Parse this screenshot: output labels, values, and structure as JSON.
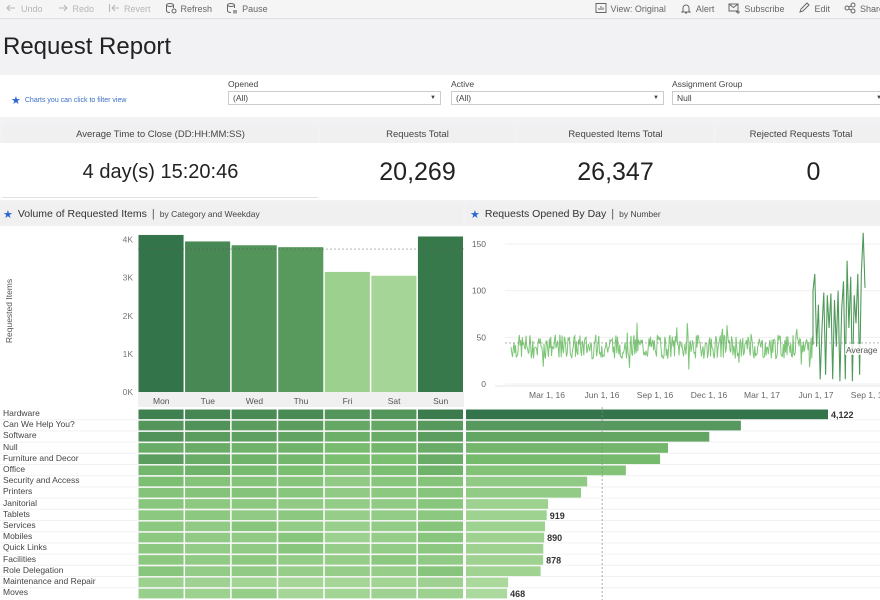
{
  "toolbar": {
    "left": [
      {
        "label": "Undo",
        "icon": "undo-arrow-icon",
        "disabled": true
      },
      {
        "label": "Redo",
        "icon": "redo-arrow-icon",
        "disabled": true
      },
      {
        "label": "Revert",
        "icon": "revert-icon",
        "disabled": true
      },
      {
        "label": "Refresh",
        "icon": "refresh-database-icon",
        "disabled": false
      },
      {
        "label": "Pause",
        "icon": "pause-database-icon",
        "disabled": false
      }
    ],
    "right": [
      {
        "label": "View: Original",
        "icon": "view-chart-icon"
      },
      {
        "label": "Alert",
        "icon": "bell-icon"
      },
      {
        "label": "Subscribe",
        "icon": "envelope-plus-icon"
      },
      {
        "label": "Edit",
        "icon": "pencil-icon"
      },
      {
        "label": "Share",
        "icon": "share-icon"
      }
    ]
  },
  "page_title": "Request Report",
  "hint": "Charts you can click to filter view",
  "filters": [
    {
      "label": "Opened",
      "value": "(All)"
    },
    {
      "label": "Active",
      "value": "(All)"
    },
    {
      "label": "Assignment Group",
      "value": "Null"
    }
  ],
  "kpis": [
    {
      "label": "Average Time to Close (DD:HH:MM:SS)",
      "value": "4 day(s) 15:20:46"
    },
    {
      "label": "Requests Total",
      "value": "20,269"
    },
    {
      "label": "Requested Items Total",
      "value": "26,347"
    },
    {
      "label": "Rejected Requests Total",
      "value": "0"
    }
  ],
  "panels": {
    "volume": {
      "title": "Volume of Requested Items",
      "sep": "|",
      "subtitle": "by Category and Weekday"
    },
    "opened": {
      "title": "Requests Opened By Day",
      "sep": "|",
      "subtitle": "by Number"
    }
  },
  "colors": {
    "accent_star": "#2b66d0",
    "dark_green": "#3a7a4c",
    "light_green": "#b8e0a8",
    "line_green": "#7cc576"
  },
  "chart_data": [
    {
      "type": "bar",
      "title": "Volume of Requested Items by Weekday",
      "categories": [
        "Mon",
        "Tue",
        "Wed",
        "Thu",
        "Fri",
        "Sat",
        "Sun"
      ],
      "values": [
        4120,
        3950,
        3850,
        3800,
        3150,
        3050,
        4080
      ],
      "ylabel": "Requested Items",
      "yticks": [
        "0K",
        "1K",
        "2K",
        "3K",
        "4K"
      ],
      "ylim": [
        0,
        4250
      ],
      "average": 3750
    },
    {
      "type": "line",
      "title": "Requests Opened By Day",
      "xticks": [
        "Mar 1, 16",
        "Jun 1, 16",
        "Sep 1, 16",
        "Dec 1, 16",
        "Mar 1, 17",
        "Jun 1, 17",
        "Sep 1, 17"
      ],
      "yticks": [
        "0",
        "50",
        "100",
        "150"
      ],
      "ylim": [
        0,
        165
      ],
      "average": 44,
      "average_label": "Average",
      "x_range": [
        "Jan 2016",
        "Sep 2017"
      ],
      "series_description": "daily counts ~25-65 through May 2017; from Jun 2017 strong weekly oscillation 0-120, peak ~162 in early Sep 2017",
      "series": [
        {
          "name": "Requests",
          "segments": [
            {
              "from": "2016-01",
              "to": "2017-05",
              "min": 18,
              "max": 66,
              "mean": 40
            },
            {
              "from": "2017-06",
              "to": "2017-09",
              "min": 0,
              "max": 162,
              "mean": 60
            }
          ]
        }
      ]
    },
    {
      "type": "heatmap",
      "title": "Volume of Requested Items by Category and Weekday",
      "columns": [
        "Mon",
        "Tue",
        "Wed",
        "Thu",
        "Fri",
        "Sat",
        "Sun"
      ],
      "rows": [
        "Hardware",
        "Can We Help You?",
        "Software",
        "Null",
        "Furniture and Decor",
        "Office",
        "Security and Access",
        "Printers",
        "Janitorial",
        "Tablets",
        "Services",
        "Mobiles",
        "Quick Links",
        "Facilities",
        "Role Delegation",
        "Maintenance and Repair",
        "Moves"
      ],
      "intensity": [
        [
          0.92,
          0.88,
          0.85,
          0.85,
          0.78,
          0.78,
          0.95
        ],
        [
          0.78,
          0.8,
          0.72,
          0.72,
          0.65,
          0.65,
          0.75
        ],
        [
          0.8,
          0.72,
          0.7,
          0.68,
          0.6,
          0.62,
          0.72
        ],
        [
          0.62,
          0.62,
          0.58,
          0.58,
          0.52,
          0.55,
          0.62
        ],
        [
          0.72,
          0.62,
          0.58,
          0.55,
          0.5,
          0.5,
          0.62
        ],
        [
          0.55,
          0.58,
          0.52,
          0.5,
          0.42,
          0.48,
          0.58
        ],
        [
          0.48,
          0.42,
          0.42,
          0.4,
          0.32,
          0.38,
          0.42
        ],
        [
          0.42,
          0.42,
          0.42,
          0.38,
          0.32,
          0.35,
          0.4
        ],
        [
          0.38,
          0.35,
          0.35,
          0.32,
          0.3,
          0.32,
          0.38
        ],
        [
          0.35,
          0.35,
          0.32,
          0.35,
          0.28,
          0.3,
          0.35
        ],
        [
          0.35,
          0.32,
          0.38,
          0.3,
          0.25,
          0.3,
          0.4
        ],
        [
          0.35,
          0.32,
          0.32,
          0.38,
          0.22,
          0.28,
          0.38
        ],
        [
          0.35,
          0.3,
          0.32,
          0.38,
          0.28,
          0.3,
          0.35
        ],
        [
          0.35,
          0.32,
          0.35,
          0.3,
          0.28,
          0.35,
          0.32
        ],
        [
          0.38,
          0.3,
          0.32,
          0.28,
          0.28,
          0.28,
          0.4
        ],
        [
          0.22,
          0.2,
          0.18,
          0.15,
          0.15,
          0.18,
          0.2
        ],
        [
          0.25,
          0.22,
          0.28,
          0.15,
          0.18,
          0.2,
          0.22
        ]
      ]
    },
    {
      "type": "bar",
      "orientation": "horizontal",
      "title": "Requested Items by Category",
      "categories": [
        "Hardware",
        "Can We Help You?",
        "Software",
        "Null",
        "Furniture and Decor",
        "Office",
        "Security and Access",
        "Printers",
        "Janitorial",
        "Tablets",
        "Services",
        "Mobiles",
        "Quick Links",
        "Facilities",
        "Role Delegation",
        "Maintenance and Repair",
        "Moves"
      ],
      "values": [
        4122,
        3130,
        2770,
        2300,
        2210,
        1820,
        1380,
        1310,
        935,
        919,
        900,
        890,
        880,
        878,
        850,
        480,
        468
      ],
      "labels": [
        "4,122",
        "",
        "",
        "",
        "",
        "",
        "",
        "",
        "",
        "919",
        "",
        "890",
        "",
        "878",
        "",
        "",
        "468"
      ],
      "average": 1550
    }
  ]
}
